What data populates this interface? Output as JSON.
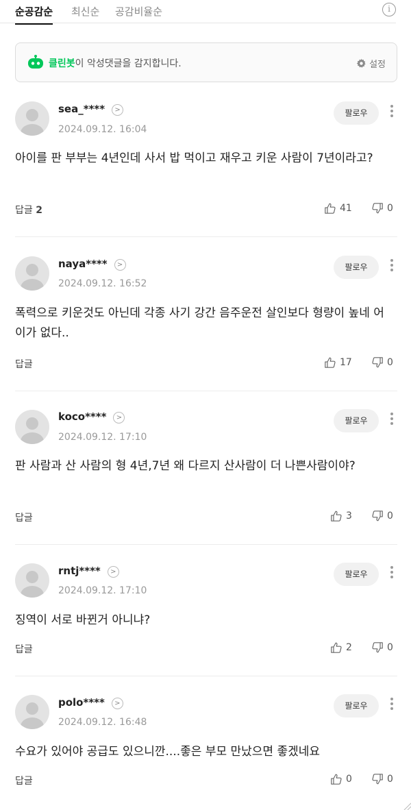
{
  "sort": {
    "tabs": [
      "순공감순",
      "최신순",
      "공감비율순"
    ],
    "info_glyph": "i"
  },
  "cleanbot": {
    "brand": "클린봇",
    "message": "이 악성댓글을 감지합니다.",
    "settings": "설정"
  },
  "comments": [
    {
      "username": "sea_****",
      "timestamp": "2024.09.12. 16:04",
      "follow": "팔로우",
      "text": "아이를 판 부부는 4년인데 사서 밥 먹이고 재우고 키운 사람이 7년이라고?",
      "reply_label": "답글",
      "reply_count": "2",
      "likes": "41",
      "dislikes": "0"
    },
    {
      "username": "naya****",
      "timestamp": "2024.09.12. 16:52",
      "follow": "팔로우",
      "text": "폭력으로 키운것도 아닌데 각종 사기 강간 음주운전 살인보다 형량이 높네 어이가 없다..",
      "reply_label": "답글",
      "reply_count": "",
      "likes": "17",
      "dislikes": "0"
    },
    {
      "username": "koco****",
      "timestamp": "2024.09.12. 17:10",
      "follow": "팔로우",
      "text": "판 사람과 산 사람의 형 4년,7년 왜 다르지 산사람이 더 나쁜사람이야?",
      "reply_label": "답글",
      "reply_count": "",
      "likes": "3",
      "dislikes": "0"
    },
    {
      "username": "rntj****",
      "timestamp": "2024.09.12. 17:10",
      "follow": "팔로우",
      "text": "징역이 서로 바뀐거 아니냐?",
      "reply_label": "답글",
      "reply_count": "",
      "likes": "2",
      "dislikes": "0"
    },
    {
      "username": "polo****",
      "timestamp": "2024.09.12. 16:48",
      "follow": "팔로우",
      "text": "수요가 있어야 공급도 있으니깐....좋은 부모 만났으면 좋겠네요",
      "reply_label": "답글",
      "reply_count": "",
      "likes": "0",
      "dislikes": "0"
    }
  ],
  "colors": {
    "brand_green": "#03c75a",
    "muted_gray": "#999999"
  }
}
